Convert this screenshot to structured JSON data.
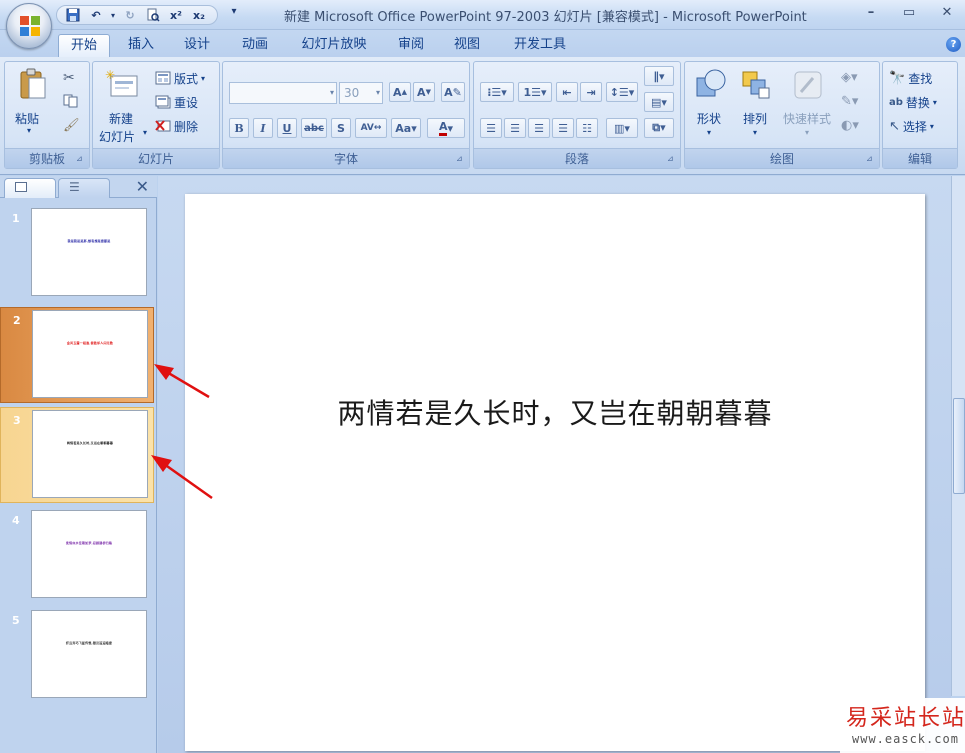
{
  "window": {
    "title": "新建 Microsoft Office PowerPoint 97-2003 幻灯片 [兼容模式] - Microsoft PowerPoint",
    "minimize": "–",
    "maximize": "▭",
    "close": "✕"
  },
  "qat": {
    "more": "▾"
  },
  "tabs": [
    "开始",
    "插入",
    "设计",
    "动画",
    "幻灯片放映",
    "审阅",
    "视图",
    "开发工具"
  ],
  "ribbon": {
    "clipboard": {
      "label": "剪贴板",
      "paste": "粘贴"
    },
    "slides": {
      "label": "幻灯片",
      "new_slide_1": "新建",
      "new_slide_2": "幻灯片",
      "layout": "版式",
      "reset": "重设",
      "delete": "删除"
    },
    "font": {
      "label": "字体",
      "font_size": "30",
      "font_name": ""
    },
    "paragraph": {
      "label": "段落"
    },
    "drawing": {
      "label": "绘图",
      "shapes": "形状",
      "arrange": "排列",
      "quick_styles": "快速样式"
    },
    "editing": {
      "label": "编辑",
      "find": "查找",
      "replace": "替换",
      "select": "选择"
    }
  },
  "slides": [
    {
      "num": "1",
      "text": "我是我是是那,想有想是您都是",
      "color": "#1a1aa0"
    },
    {
      "num": "2",
      "text": "金风玉露一相逢,便胜却人间无数",
      "color": "#e02020"
    },
    {
      "num": "3",
      "text": "两情若是久长时,又岂在朝朝暮暮",
      "color": "#222222"
    },
    {
      "num": "4",
      "text": "柔情似水佳期如梦,忍顾鹊桥归路",
      "color": "#7a2aa8"
    },
    {
      "num": "5",
      "text": "纤云弄巧飞星传恨,银汉迢迢暗度",
      "color": "#222222"
    }
  ],
  "current_slide": {
    "text": "两情若是久长时，又岂在朝朝暮暮"
  },
  "watermark": {
    "main": "易采站长站",
    "sub": "www.easck.com"
  },
  "colors": {
    "annotation_arrow": "#e01010",
    "selected_slide": "#d98942",
    "hover_slide": "#f7d591"
  }
}
